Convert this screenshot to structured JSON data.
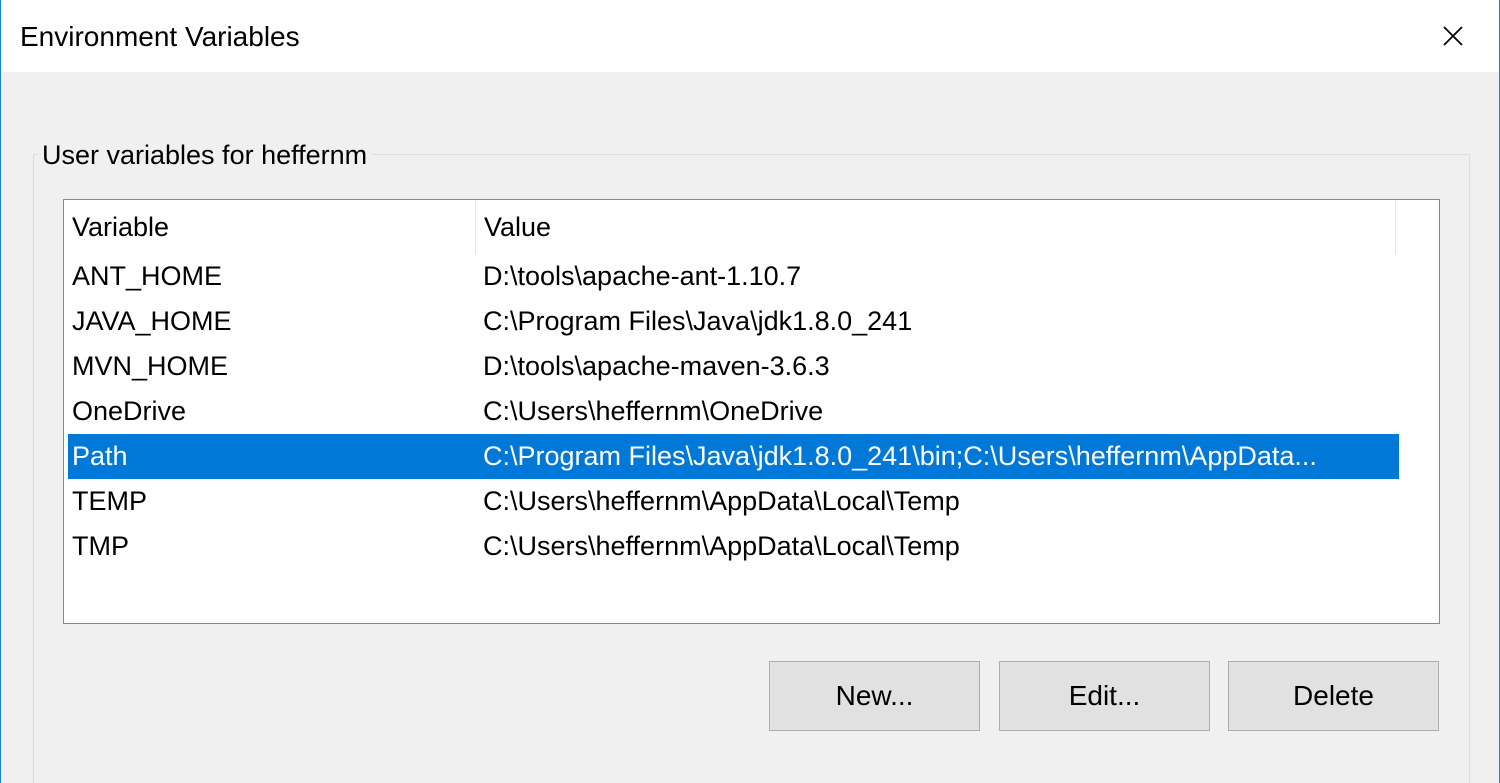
{
  "window": {
    "title": "Environment Variables",
    "close_icon": "close-icon"
  },
  "user_variables": {
    "group_label": "User variables for heffernm",
    "columns": [
      "Variable",
      "Value"
    ],
    "rows": [
      {
        "name": "ANT_HOME",
        "value": "D:\\tools\\apache-ant-1.10.7",
        "selected": false
      },
      {
        "name": "JAVA_HOME",
        "value": "C:\\Program Files\\Java\\jdk1.8.0_241",
        "selected": false
      },
      {
        "name": "MVN_HOME",
        "value": "D:\\tools\\apache-maven-3.6.3",
        "selected": false
      },
      {
        "name": "OneDrive",
        "value": "C:\\Users\\heffernm\\OneDrive",
        "selected": false
      },
      {
        "name": "Path",
        "value": "C:\\Program Files\\Java\\jdk1.8.0_241\\bin;C:\\Users\\heffernm\\AppData...",
        "selected": true
      },
      {
        "name": "TEMP",
        "value": "C:\\Users\\heffernm\\AppData\\Local\\Temp",
        "selected": false
      },
      {
        "name": "TMP",
        "value": "C:\\Users\\heffernm\\AppData\\Local\\Temp",
        "selected": false
      }
    ],
    "buttons": {
      "new": "New...",
      "edit": "Edit...",
      "delete": "Delete"
    }
  },
  "colors": {
    "selection": "#0078d7",
    "window_border": "#1883d7",
    "background": "#f0f0f0"
  }
}
